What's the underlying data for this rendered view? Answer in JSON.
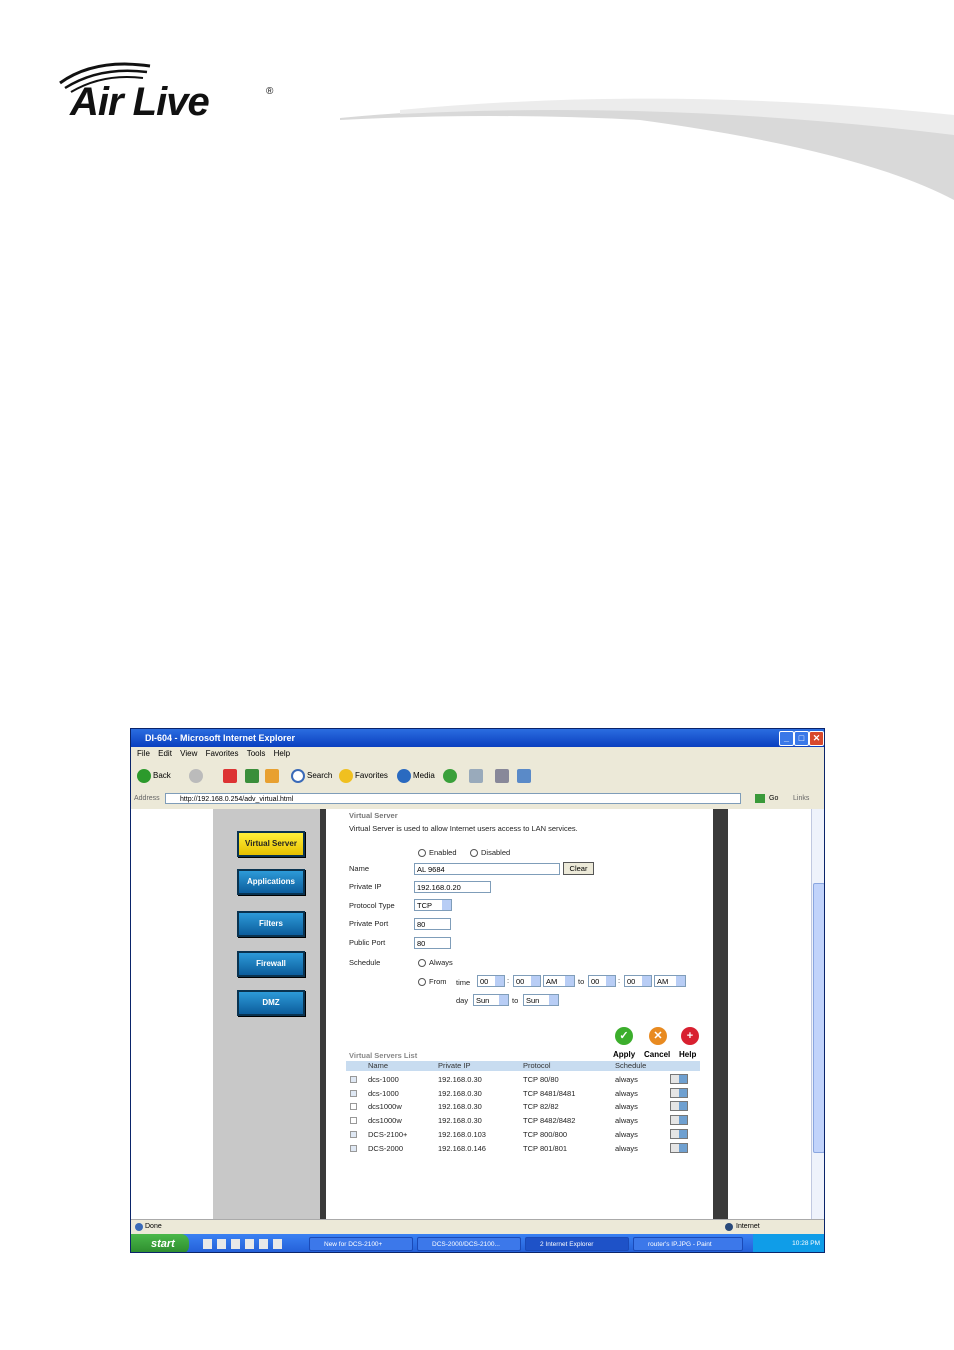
{
  "logo": {
    "text": "Air Live",
    "registered": "®"
  },
  "window": {
    "title": "DI-604 - Microsoft Internet Explorer",
    "minimize": "_",
    "maximize": "□",
    "close": "✕"
  },
  "menu": [
    "File",
    "Edit",
    "View",
    "Favorites",
    "Tools",
    "Help"
  ],
  "toolbar": {
    "back": "Back",
    "search": "Search",
    "favorites": "Favorites",
    "media": "Media"
  },
  "address": {
    "label": "Address",
    "url": "http://192.168.0.254/adv_virtual.html",
    "go": "Go",
    "links": "Links"
  },
  "nav": [
    "Virtual Server",
    "Applications",
    "Filters",
    "Firewall",
    "DMZ"
  ],
  "form": {
    "section_title": "Virtual Server",
    "description": "Virtual Server is used to allow Internet users access to LAN services.",
    "enabled": "Enabled",
    "disabled": "Disabled",
    "name_label": "Name",
    "name_value": "AL 9684",
    "clear": "Clear",
    "private_ip_label": "Private IP",
    "private_ip_value": "192.168.0.20",
    "protocol_label": "Protocol Type",
    "protocol_value": "TCP",
    "private_port_label": "Private Port",
    "private_port_value": "80",
    "public_port_label": "Public Port",
    "public_port_value": "80",
    "schedule_label": "Schedule",
    "always": "Always",
    "from": "From",
    "time": "time",
    "h1": "00",
    "m1": "00",
    "ap1": "AM",
    "to": "to",
    "h2": "00",
    "m2": "00",
    "ap2": "AM",
    "colon": ":",
    "day": "day",
    "day1": "Sun",
    "day2": "Sun"
  },
  "actions": {
    "apply": "Apply",
    "cancel": "Cancel",
    "help": "Help"
  },
  "list": {
    "title": "Virtual Servers List",
    "headers": [
      "Name",
      "Private IP",
      "Protocol",
      "Schedule"
    ],
    "rows": [
      {
        "name": "dcs-1000",
        "ip": "192.168.0.30",
        "protocol": "TCP 80/80",
        "schedule": "always",
        "checked": true
      },
      {
        "name": "dcs-1000",
        "ip": "192.168.0.30",
        "protocol": "TCP 8481/8481",
        "schedule": "always",
        "checked": true
      },
      {
        "name": "dcs1000w",
        "ip": "192.168.0.30",
        "protocol": "TCP 82/82",
        "schedule": "always",
        "checked": false
      },
      {
        "name": "dcs1000w",
        "ip": "192.168.0.30",
        "protocol": "TCP 8482/8482",
        "schedule": "always",
        "checked": false
      },
      {
        "name": "DCS-2100+",
        "ip": "192.168.0.103",
        "protocol": "TCP 800/800",
        "schedule": "always",
        "checked": true
      },
      {
        "name": "DCS-2000",
        "ip": "192.168.0.146",
        "protocol": "TCP 801/801",
        "schedule": "always",
        "checked": true
      }
    ]
  },
  "status": {
    "left": "Done",
    "zone": "Internet"
  },
  "taskbar": {
    "start": "start",
    "tasks": [
      "New for DCS-2100+",
      "DCS-2000/DCS-2100...",
      "2 Internet Explorer",
      "router's IP.JPG - Paint"
    ],
    "clock": "10:28 PM"
  },
  "colors": {
    "accent": "#0a3fbf",
    "nav_active": "#ffe020",
    "nav": "#1b7cc0"
  }
}
